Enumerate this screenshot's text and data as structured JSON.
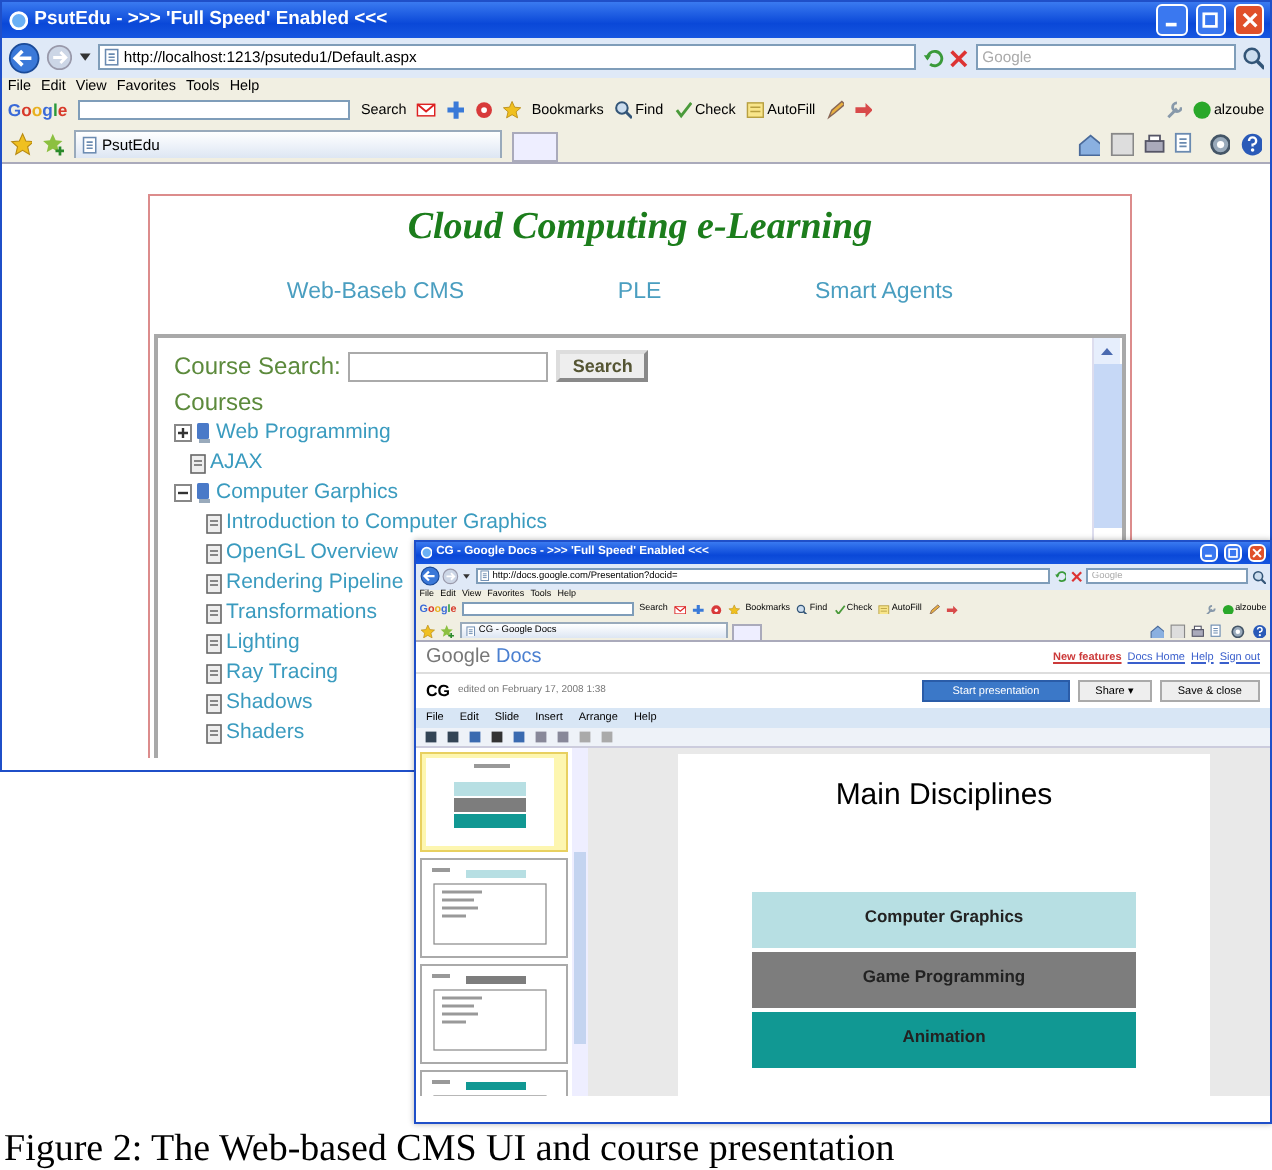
{
  "browser": {
    "title": "PsutEdu - >>> 'Full Speed' Enabled <<<",
    "address": "http://localhost:1213/psutedu1/Default.aspx",
    "search_placeholder": "Google",
    "menu": [
      "File",
      "Edit",
      "View",
      "Favorites",
      "Tools",
      "Help"
    ],
    "google_label": "Google",
    "toolbar": [
      "Search",
      "Bookmarks",
      "Find",
      "Check",
      "AutoFill"
    ],
    "user": "alzoube",
    "tab": "PsutEdu"
  },
  "site": {
    "title": "Cloud Computing e-Learning",
    "nav": [
      "Web-Baseb CMS",
      "PLE",
      "Smart Agents"
    ],
    "search_label": "Course Search:",
    "search_button": "Search",
    "courses_heading": "Courses",
    "courses": [
      {
        "kind": "folder",
        "label": "Web Programming",
        "expanded": false
      },
      {
        "kind": "doc",
        "label": "AJAX"
      },
      {
        "kind": "folder",
        "label": "Computer Garphics",
        "expanded": true,
        "children": [
          {
            "kind": "doc",
            "label": "Introduction to Computer Graphics"
          },
          {
            "kind": "doc",
            "label": "OpenGL Overview"
          },
          {
            "kind": "doc",
            "label": "Rendering Pipeline"
          },
          {
            "kind": "doc",
            "label": "Transformations"
          },
          {
            "kind": "doc",
            "label": "Lighting"
          },
          {
            "kind": "doc",
            "label": "Ray Tracing"
          },
          {
            "kind": "doc",
            "label": "Shadows"
          },
          {
            "kind": "doc",
            "label": "Shaders"
          }
        ]
      }
    ]
  },
  "docs_window": {
    "browser": {
      "title": "CG - Google Docs - >>> 'Full Speed' Enabled <<<",
      "address": "http://docs.google.com/Presentation?docid=",
      "search_placeholder": "Google",
      "menu": [
        "File",
        "Edit",
        "View",
        "Favorites",
        "Tools",
        "Help"
      ],
      "google_label": "Google",
      "toolbar": [
        "Search",
        "Bookmarks",
        "Find",
        "Check",
        "AutoFill"
      ],
      "user": "alzoube",
      "tab": "CG - Google Docs"
    },
    "logo": [
      "Google",
      "Docs"
    ],
    "links": [
      "New features",
      "Docs Home",
      "Help",
      "Sign out"
    ],
    "doc_name": "CG",
    "edited": "edited on February 17, 2008 1:38",
    "buttons": [
      {
        "label": "Start presentation",
        "kind": "primary"
      },
      {
        "label": "Share ▾",
        "kind": "plain"
      },
      {
        "label": "Save & close",
        "kind": "plain"
      }
    ],
    "menu": [
      "File",
      "Edit",
      "Slide",
      "Insert",
      "Arrange",
      "Help"
    ],
    "thumbnails": [
      {
        "selected": true
      },
      {
        "selected": false
      },
      {
        "selected": false
      },
      {
        "selected": false
      }
    ],
    "slide": {
      "title": "Main Disciplines",
      "blocks": [
        {
          "label": "Computer Graphics",
          "color": "#b7dfe3"
        },
        {
          "label": "Game Programming",
          "color": "#7d7d7d"
        },
        {
          "label": "Animation",
          "color": "#119893"
        }
      ]
    }
  },
  "caption": "Figure 2: The Web-based CMS UI and course presentation"
}
